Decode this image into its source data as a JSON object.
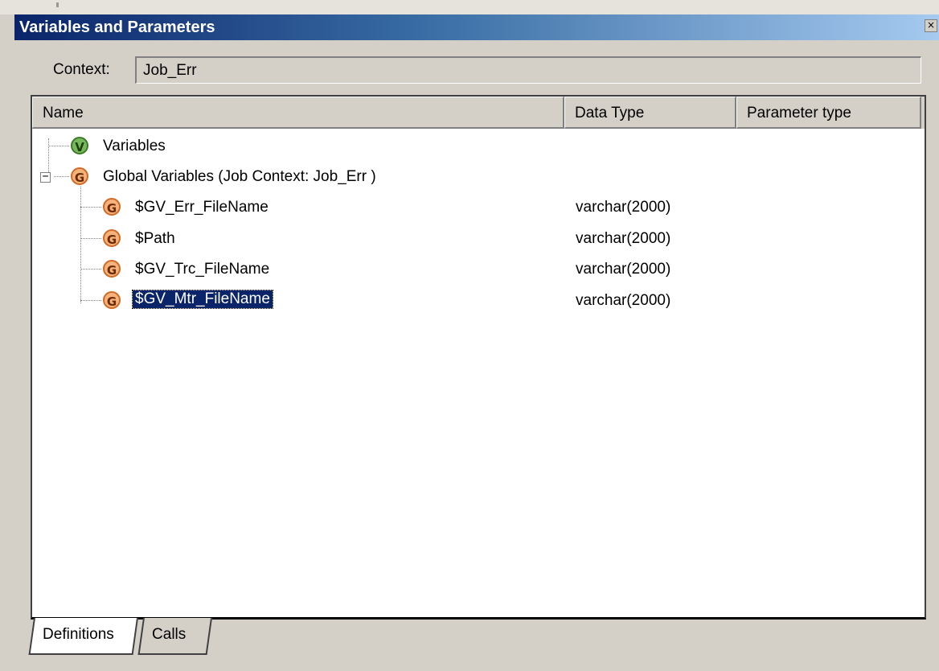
{
  "window": {
    "title": "Variables and Parameters",
    "close_glyph": "×"
  },
  "context": {
    "label": "Context:",
    "value": "Job_Err"
  },
  "columns": {
    "name": "Name",
    "data_type": "Data Type",
    "parameter_type": "Parameter type"
  },
  "tree": {
    "variables_node": {
      "icon_letter": "V",
      "label": "Variables",
      "icon": "variable-icon"
    },
    "global_node": {
      "icon_letter": "G",
      "label": "Global Variables (Job Context: Job_Err )",
      "icon": "global-variable-icon",
      "expander": "−"
    },
    "items": [
      {
        "icon_letter": "G",
        "name": "$GV_Err_FileName",
        "data_type": "varchar(2000)"
      },
      {
        "icon_letter": "G",
        "name": "$Path",
        "data_type": "varchar(2000)"
      },
      {
        "icon_letter": "G",
        "name": "$GV_Trc_FileName",
        "data_type": "varchar(2000)"
      },
      {
        "icon_letter": "G",
        "name": "$GV_Mtr_FileName",
        "data_type": "varchar(2000)",
        "selected": true
      }
    ]
  },
  "tabs": [
    {
      "label": "Definitions",
      "active": true
    },
    {
      "label": "Calls",
      "active": false
    }
  ],
  "colors": {
    "titlebar_start": "#0a246a",
    "selection": "#0a246a",
    "variable_icon": "#78b85a",
    "global_icon": "#f5b27a"
  }
}
